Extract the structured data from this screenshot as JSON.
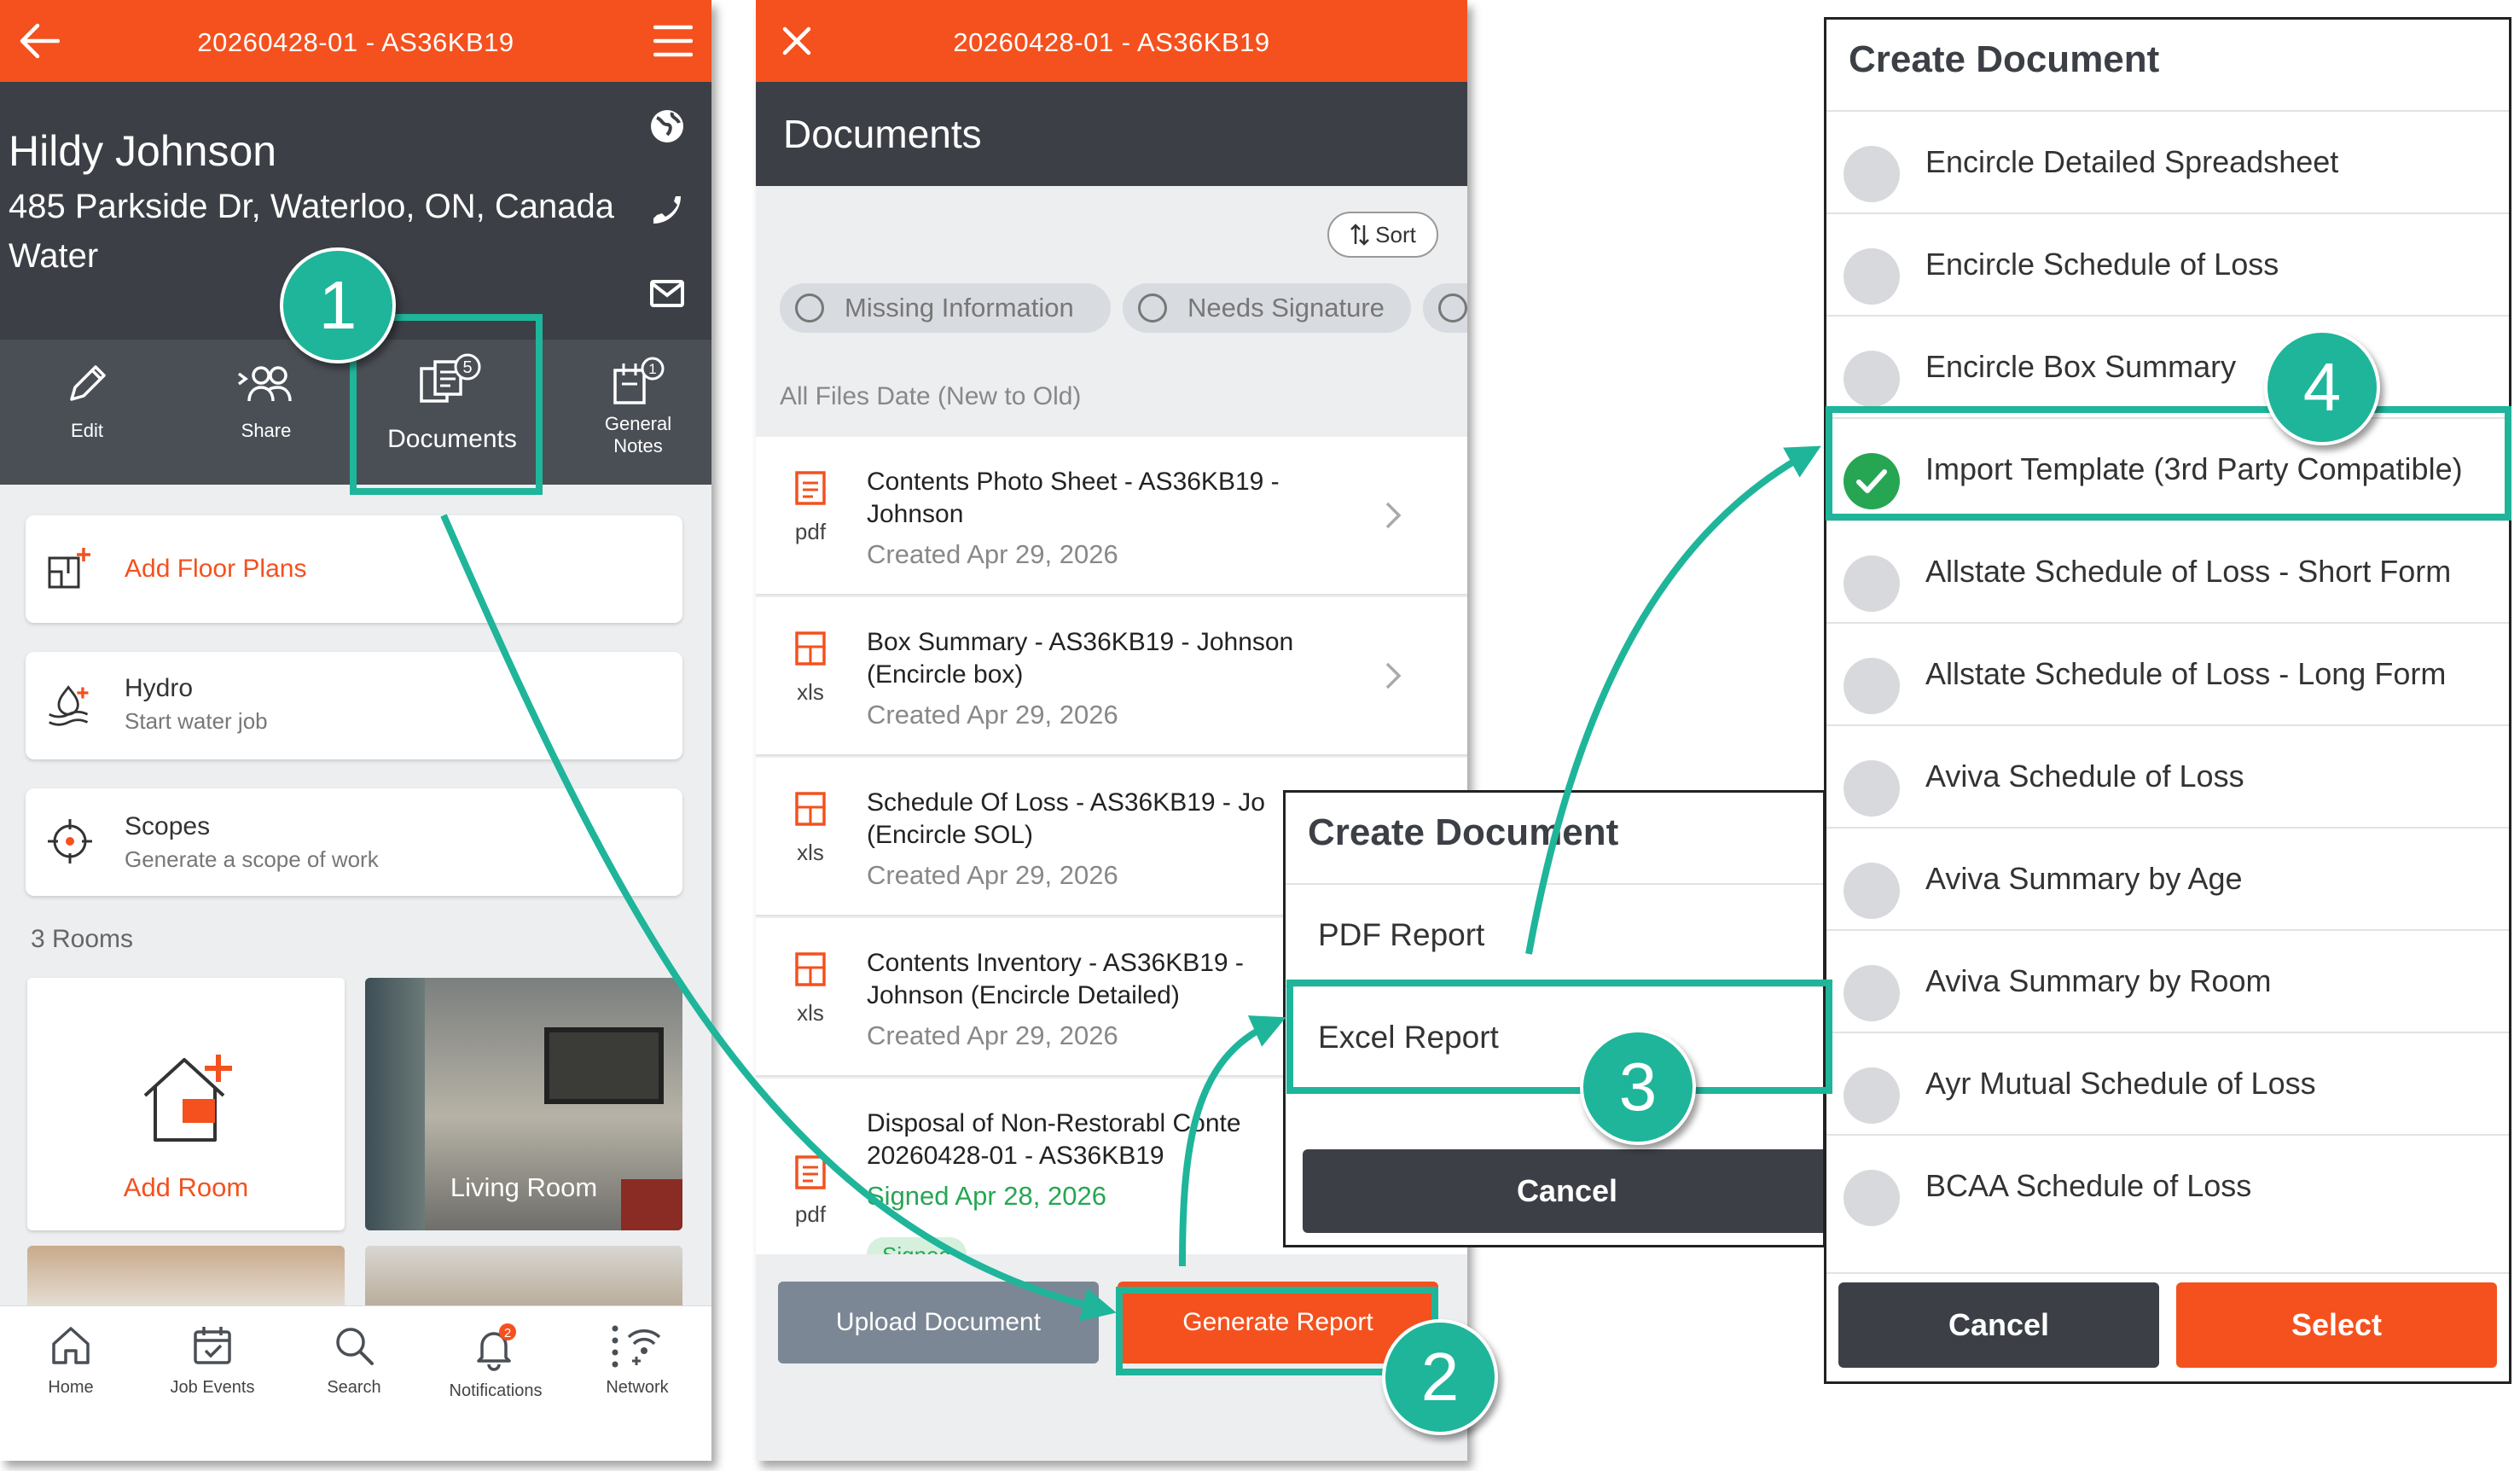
{
  "colors": {
    "orange": "#f4511e",
    "dark": "#3c4046",
    "teal": "#1fb59a",
    "green": "#26a653"
  },
  "panel1": {
    "title": "20260428-01 - AS36KB19",
    "customer": {
      "name": "Hildy Johnson",
      "address": "485 Parkside Dr, Waterloo, ON, Canada",
      "loss_type": "Water"
    },
    "actions": [
      {
        "label": "Edit",
        "icon": "pencil-icon"
      },
      {
        "label": "Share",
        "icon": "share-people-icon"
      },
      {
        "label": "Documents",
        "icon": "documents-icon",
        "badge": "5"
      },
      {
        "label": "General\nNotes",
        "icon": "notes-icon",
        "badge": "1"
      }
    ],
    "cards": {
      "floor_plans": "Add Floor Plans",
      "hydro_title": "Hydro",
      "hydro_sub": "Start water job",
      "scopes_title": "Scopes",
      "scopes_sub": "Generate a scope of work"
    },
    "rooms_label": "3 Rooms",
    "add_room": "Add Room",
    "living_room": "Living Room",
    "nav": [
      {
        "label": "Home",
        "icon": "home-icon"
      },
      {
        "label": "Job Events",
        "icon": "calendar-icon"
      },
      {
        "label": "Search",
        "icon": "search-icon"
      },
      {
        "label": "Notifications",
        "icon": "bell-icon",
        "badge": "2"
      },
      {
        "label": "Network",
        "icon": "network-icon"
      }
    ]
  },
  "panel2": {
    "title": "20260428-01 - AS36KB19",
    "heading": "Documents",
    "sort": "Sort",
    "filters": [
      "Missing Information",
      "Needs Signature"
    ],
    "sort_label": "All Files Date (New to Old)",
    "documents": [
      {
        "name": "Contents Photo Sheet - AS36KB19 - Johnson",
        "ext": "pdf",
        "date": "Created Apr 29, 2026"
      },
      {
        "name": "Box Summary - AS36KB19 - Johnson (Encircle box)",
        "ext": "xls",
        "date": "Created Apr 29, 2026"
      },
      {
        "name": "Schedule Of Loss - AS36KB19 - Jo (Encircle SOL)",
        "ext": "xls",
        "date": "Created Apr 29, 2026"
      },
      {
        "name": "Contents Inventory - AS36KB19 - Johnson (Encircle Detailed)",
        "ext": "xls",
        "date": "Created Apr 29, 2026"
      },
      {
        "name": "Disposal of Non-Restorabl Conte 20260428-01 - AS36KB19",
        "ext": "pdf",
        "date": "Signed Apr 28, 2026",
        "status": "Signed"
      }
    ],
    "upload": "Upload Document",
    "generate": "Generate Report"
  },
  "dialog3": {
    "title": "Create Document",
    "options": [
      "PDF Report",
      "Excel Report"
    ],
    "cancel": "Cancel"
  },
  "dialog4": {
    "title": "Create Document",
    "options": [
      "Encircle Detailed Spreadsheet",
      "Encircle Schedule of Loss",
      "Encircle Box Summary",
      "Import Template (3rd Party Compatible)",
      "Allstate Schedule of Loss - Short Form",
      "Allstate Schedule of Loss - Long Form",
      "Aviva Schedule of Loss",
      "Aviva Summary by Age",
      "Aviva Summary by Room",
      "Ayr Mutual Schedule of Loss",
      "BCAA Schedule of Loss"
    ],
    "selected_index": 3,
    "cancel": "Cancel",
    "select": "Select"
  },
  "steps": [
    "1",
    "2",
    "3",
    "4"
  ]
}
